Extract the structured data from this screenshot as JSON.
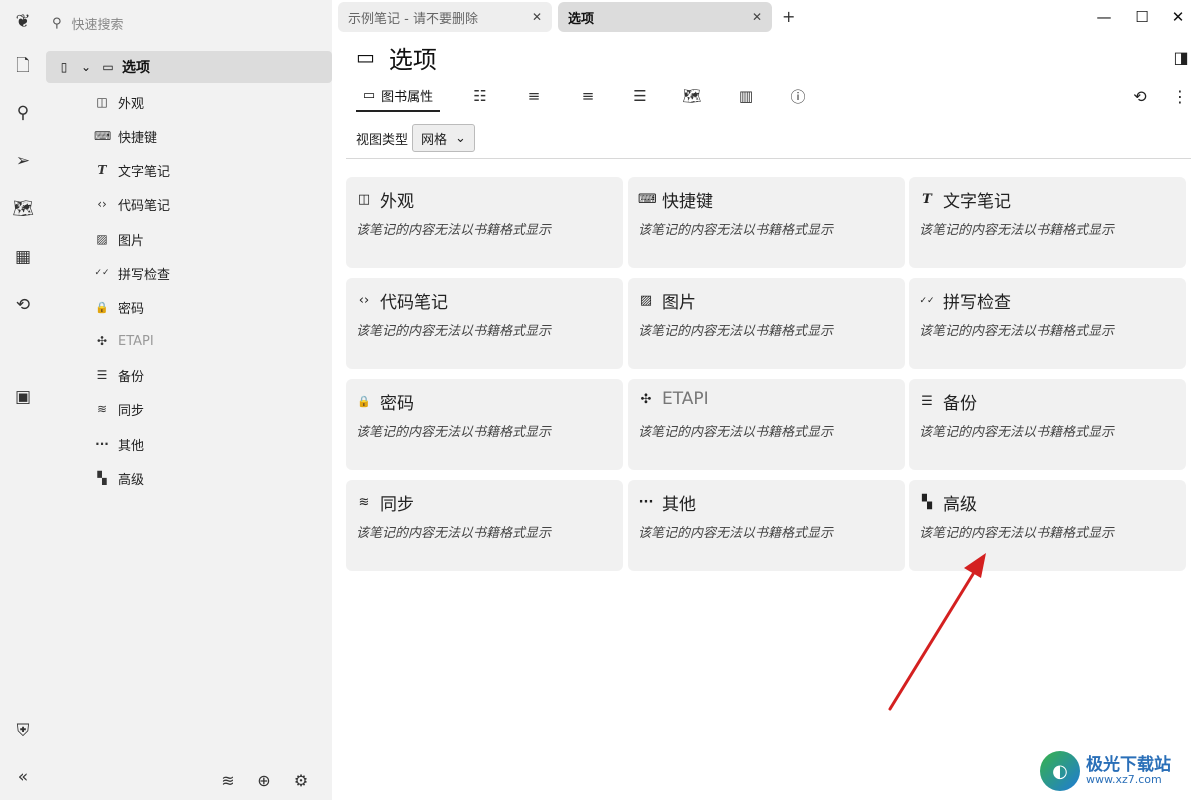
{
  "launcher": {
    "items": [
      {
        "name": "new-note-icon",
        "glyph": "🗋"
      },
      {
        "name": "search-icon",
        "glyph": "⚲"
      },
      {
        "name": "jump-to-note-icon",
        "glyph": "➢"
      },
      {
        "name": "note-map-icon",
        "glyph": "🗺"
      },
      {
        "name": "calendar-icon",
        "glyph": "▦"
      },
      {
        "name": "recent-changes-icon",
        "glyph": "⟲"
      },
      {
        "name": "today-note-icon",
        "glyph": "▣"
      },
      {
        "name": "protected-session-icon",
        "glyph": "⛨"
      },
      {
        "name": "collapse-sidebar-icon",
        "glyph": "«"
      }
    ]
  },
  "tree": {
    "search_placeholder": "快速搜索",
    "root": {
      "label": "选项"
    },
    "items": [
      {
        "label": "外观",
        "icon": "layout-icon",
        "glyph": "◫"
      },
      {
        "label": "快捷键",
        "icon": "keyboard-icon",
        "glyph": "⌨"
      },
      {
        "label": "文字笔记",
        "icon": "text-icon",
        "glyph": "T"
      },
      {
        "label": "代码笔记",
        "icon": "code-icon",
        "glyph": "‹›"
      },
      {
        "label": "图片",
        "icon": "image-icon",
        "glyph": "▨"
      },
      {
        "label": "拼写检查",
        "icon": "spellcheck-icon",
        "glyph": "✓✓"
      },
      {
        "label": "密码",
        "icon": "lock-icon",
        "glyph": "🔒"
      },
      {
        "label": "ETAPI",
        "icon": "extension-icon",
        "glyph": "✣"
      },
      {
        "label": "备份",
        "icon": "database-icon",
        "glyph": "☰"
      },
      {
        "label": "同步",
        "icon": "wifi-icon",
        "glyph": "≋"
      },
      {
        "label": "其他",
        "icon": "dots-icon",
        "glyph": "···"
      },
      {
        "label": "高级",
        "icon": "grid-icon",
        "glyph": "▚"
      }
    ]
  },
  "tabs": [
    {
      "label": "示例笔记 - 请不要删除"
    },
    {
      "label": "选项"
    }
  ],
  "note": {
    "title": "选项",
    "ribbon_active_label": "图书属性",
    "view_type_label": "视图类型",
    "view_type_value": "网格"
  },
  "cards": [
    {
      "title": "外观",
      "icon": "layout-icon",
      "glyph": "◫"
    },
    {
      "title": "快捷键",
      "icon": "keyboard-icon",
      "glyph": "⌨"
    },
    {
      "title": "文字笔记",
      "icon": "text-icon",
      "glyph": "T"
    },
    {
      "title": "代码笔记",
      "icon": "code-icon",
      "glyph": "‹›"
    },
    {
      "title": "图片",
      "icon": "image-icon",
      "glyph": "▨"
    },
    {
      "title": "拼写检查",
      "icon": "spellcheck-icon",
      "glyph": "✓✓"
    },
    {
      "title": "密码",
      "icon": "lock-icon",
      "glyph": "🔒"
    },
    {
      "title": "ETAPI",
      "icon": "extension-icon",
      "glyph": "✣"
    },
    {
      "title": "备份",
      "icon": "database-icon",
      "glyph": "☰"
    },
    {
      "title": "同步",
      "icon": "wifi-icon",
      "glyph": "≋"
    },
    {
      "title": "其他",
      "icon": "dots-icon",
      "glyph": "···"
    },
    {
      "title": "高级",
      "icon": "grid-icon",
      "glyph": "▚"
    }
  ],
  "card_description": "该笔记的内容无法以书籍格式显示",
  "watermark": {
    "name": "极光下载站",
    "url": "www.xz7.com"
  },
  "colors": {
    "annotation_arrow": "#d42020",
    "watermark": "#2a6fb8"
  }
}
